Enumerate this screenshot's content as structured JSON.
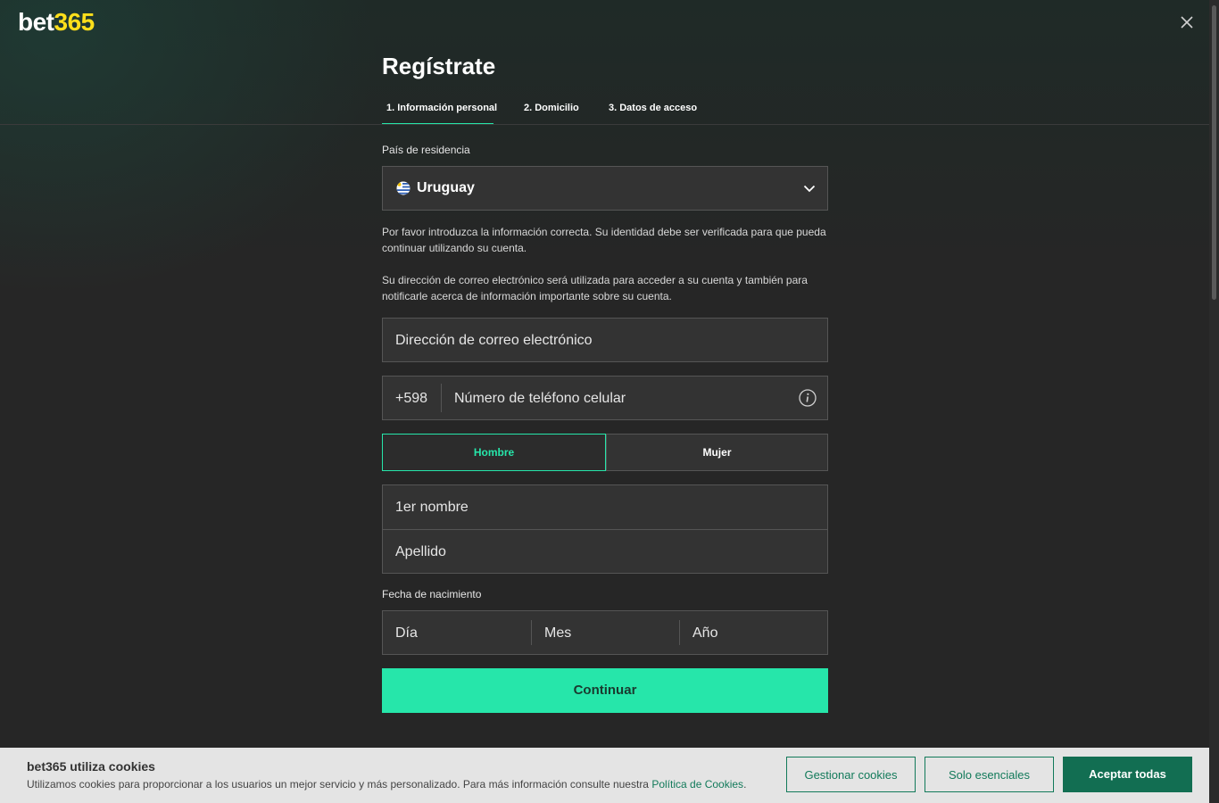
{
  "header": {
    "logo_part1": "bet",
    "logo_part2": "365",
    "close_icon": "close-icon"
  },
  "page": {
    "title": "Regístrate"
  },
  "tabs": [
    {
      "label": "1.  Información personal",
      "active": true
    },
    {
      "label": "2.  Domicilio",
      "active": false
    },
    {
      "label": "3.  Datos de acceso",
      "active": false
    }
  ],
  "form": {
    "country_label": "País de residencia",
    "country_value": "Uruguay",
    "country_flag_icon": "uruguay-flag-icon",
    "identity_notice": "Por favor introduzca la información correcta. Su identidad debe ser verificada para que pueda continuar utilizando su cuenta.",
    "email_notice": "Su dirección de correo electrónico será utilizada para acceder a su cuenta y también para notificarle acerca de información importante sobre su cuenta.",
    "email_placeholder": "Dirección de correo electrónico",
    "phone_prefix": "+598",
    "phone_placeholder": "Número de teléfono celular",
    "gender_male": "Hombre",
    "gender_female": "Mujer",
    "gender_selected": "Hombre",
    "first_name_placeholder": "1er nombre",
    "last_name_placeholder": "Apellido",
    "dob_label": "Fecha de nacimiento",
    "dob_day": "Día",
    "dob_month": "Mes",
    "dob_year": "Año",
    "continue_label": "Continuar"
  },
  "cookies": {
    "title": "bet365 utiliza cookies",
    "text": "Utilizamos cookies para proporcionar a los usuarios un mejor servicio y más personalizado. Para más información consulte nuestra ",
    "link": "Política de Cookies",
    "text_end": ".",
    "manage_label": "Gestionar cookies",
    "essential_label": "Solo esenciales",
    "accept_label": "Aceptar todas"
  },
  "colors": {
    "accent": "#26e6aa",
    "logo_yellow": "#ffdf1b",
    "cookie_green": "#126e52"
  }
}
